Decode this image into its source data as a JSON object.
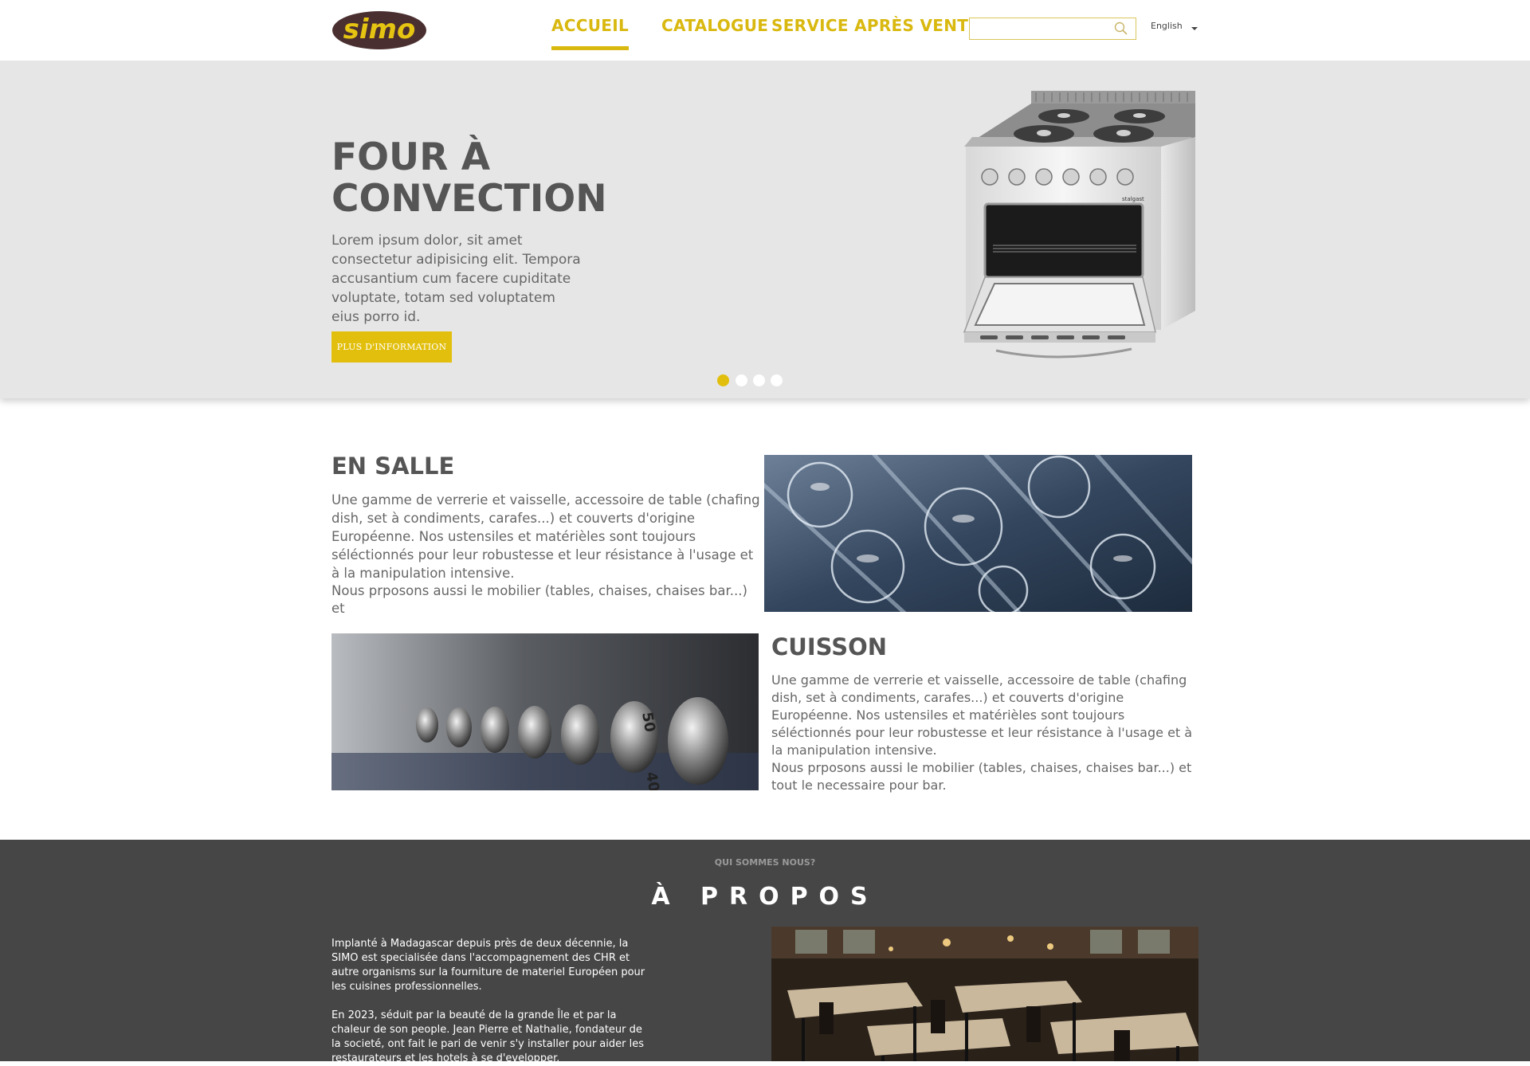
{
  "header": {
    "logo_text": "simo",
    "nav": [
      "ACCUEIL",
      "CATALOGUE",
      "SERVICE APRÈS VENTE"
    ],
    "active_nav": "ACCUEIL",
    "search_placeholder": "",
    "language": "English"
  },
  "hero": {
    "title_line1": "FOUR À",
    "title_line2": "CONVECTION",
    "text": "Lorem ipsum dolor, sit amet consectetur adipisicing elit. Tempora accusantium cum facere cupiditate voluptate, totam sed voluptatem eius porro id.",
    "button": "PLUS D'INFORMATION",
    "slides": 4,
    "active_slide": 1,
    "stove_brand": "stalgast"
  },
  "en_salle": {
    "title": "EN SALLE",
    "para1": "Une gamme de verrerie et vaisselle, accessoire de table (chafing dish, set à condiments, carafes...) et couverts d'origine Européenne. Nos ustensiles et matérièles sont toujours séléctionnés pour leur robustesse et leur résistance à l'usage et à la manipulation intensive.",
    "para2": "Nous prposons aussi le mobilier (tables, chaises, chaises bar...) et"
  },
  "cuisson": {
    "title": "CUISSON",
    "para1": "Une gamme de verrerie et vaisselle, accessoire de table (chafing dish, set à condiments, carafes...) et couverts d'origine Européenne. Nos ustensiles et matérièles sont toujours séléctionnés pour leur robustesse et leur résistance à l'usage et à la manipulation intensive.",
    "para2": "Nous prposons aussi le mobilier (tables, chaises, chaises bar...) et tout le necessaire pour bar.",
    "knob_labels": [
      "50",
      "40"
    ]
  },
  "about": {
    "kicker": "QUI SOMMES NOUS?",
    "title": "À PROPOS",
    "para1": "Implanté à Madagascar depuis près de deux décennie, la SIMO est specialisée dans l'accompagnement des CHR et autre organisms sur la fourniture de materiel Européen pour les cuisines professionnelles.",
    "para2": "En 2023, séduit par la beauté de la grande Île et par la chaleur de son people. Jean Pierre et Nathalie, fondateur de la societé, ont fait le pari de venir s'y installer pour aider les restaurateurs et les hotels à se d'evelopper."
  },
  "colors": {
    "accent": "#e2bf0d",
    "logo_bg": "#4a2f30",
    "hero_bg": "#e6e6e6",
    "about_bg": "#474646"
  },
  "icons": [
    "search-icon",
    "chevron-down-icon"
  ]
}
